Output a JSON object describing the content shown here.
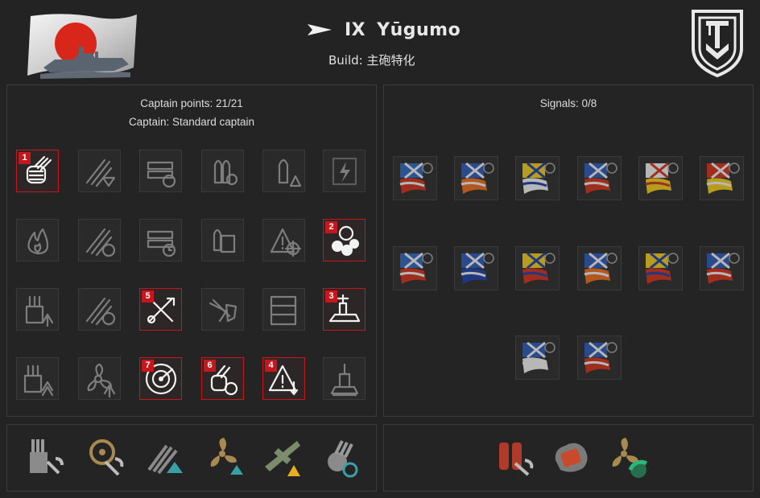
{
  "header": {
    "tier": "IX",
    "ship_name": "Yūgumo",
    "build_label": "Build: 主砲特化",
    "nation_flag_icon": "japan-flag-icon",
    "ship_class_icon": "destroyer-class-icon",
    "emblem_icon": "tier-emblem-icon"
  },
  "captain": {
    "points_text": "Captain points: 21/21",
    "captain_text": "Captain: Standard captain"
  },
  "skills": [
    {
      "icon": "main-battery-reload-icon",
      "selected": true,
      "order": "1"
    },
    {
      "icon": "torpedo-ready-alert-icon",
      "selected": false,
      "order": ""
    },
    {
      "icon": "consumable-reload-icon",
      "selected": false,
      "order": ""
    },
    {
      "icon": "shell-reload-icon",
      "selected": false,
      "order": ""
    },
    {
      "icon": "shell-warning-icon",
      "selected": false,
      "order": ""
    },
    {
      "icon": "lightning-icon",
      "selected": false,
      "order": ""
    },
    {
      "icon": "fire-icon",
      "selected": false,
      "order": ""
    },
    {
      "icon": "torpedo-speed-icon",
      "selected": false,
      "order": ""
    },
    {
      "icon": "consumable-timer-icon",
      "selected": false,
      "order": ""
    },
    {
      "icon": "ammo-crate-icon",
      "selected": false,
      "order": ""
    },
    {
      "icon": "target-warning-icon",
      "selected": false,
      "order": ""
    },
    {
      "icon": "smoke-helm-icon",
      "selected": true,
      "order": "2"
    },
    {
      "icon": "turret-upgrade-icon",
      "selected": false,
      "order": ""
    },
    {
      "icon": "torpedo-reload-icon",
      "selected": false,
      "order": ""
    },
    {
      "icon": "crossed-tools-icon",
      "selected": true,
      "order": "5"
    },
    {
      "icon": "aircraft-shield-icon",
      "selected": false,
      "order": ""
    },
    {
      "icon": "container-icon",
      "selected": false,
      "order": ""
    },
    {
      "icon": "battleship-icon",
      "selected": true,
      "order": "3"
    },
    {
      "icon": "turret-boost-icon",
      "selected": false,
      "order": ""
    },
    {
      "icon": "propeller-up-icon",
      "selected": false,
      "order": ""
    },
    {
      "icon": "radar-icon",
      "selected": true,
      "order": "7"
    },
    {
      "icon": "shell-cycle-icon",
      "selected": true,
      "order": "6"
    },
    {
      "icon": "warning-down-icon",
      "selected": true,
      "order": "4"
    },
    {
      "icon": "ship-silhouette-icon",
      "selected": false,
      "order": ""
    }
  ],
  "signals": {
    "count_text": "Signals: 0/8",
    "items": [
      {
        "icon": "signal-flag-1-icon",
        "colors": [
          "#2a62b8",
          "#e6e6e6",
          "#c8301a"
        ]
      },
      {
        "icon": "signal-flag-2-icon",
        "colors": [
          "#2a55b0",
          "#e6e6e6",
          "#e0661a"
        ]
      },
      {
        "icon": "signal-flag-3-icon",
        "colors": [
          "#e8c21a",
          "#1a3f9e",
          "#e6e6e6"
        ]
      },
      {
        "icon": "signal-flag-4-icon",
        "colors": [
          "#2a55b0",
          "#e6e6e6",
          "#c8301a"
        ]
      },
      {
        "icon": "signal-flag-5-icon",
        "colors": [
          "#e6e6e6",
          "#c8301a",
          "#e8c21a"
        ]
      },
      {
        "icon": "signal-flag-6-icon",
        "colors": [
          "#c8301a",
          "#e6e6e6",
          "#e8c21a"
        ]
      },
      {
        "icon": "signal-flag-7-icon",
        "colors": [
          "#2a62b8",
          "#e6e6e6",
          "#c8301a"
        ]
      },
      {
        "icon": "signal-flag-8-icon",
        "colors": [
          "#2a55b0",
          "#e6e6e6",
          "#1a3f9e"
        ]
      },
      {
        "icon": "signal-flag-9-icon",
        "colors": [
          "#e8c21a",
          "#1a3f9e",
          "#c8301a"
        ]
      },
      {
        "icon": "signal-flag-10-icon",
        "colors": [
          "#2a55b0",
          "#e6e6e6",
          "#e0661a"
        ]
      },
      {
        "icon": "signal-flag-11-icon",
        "colors": [
          "#e8c21a",
          "#1a3f9e",
          "#c8301a"
        ]
      },
      {
        "icon": "signal-flag-12-icon",
        "colors": [
          "#2a55b0",
          "#e6e6e6",
          "#c8301a"
        ]
      },
      {
        "icon": "signal-flag-13-icon",
        "colors": [
          "#2a55b0",
          "#e6e6e6",
          "#e6e6e6"
        ]
      },
      {
        "icon": "signal-flag-14-icon",
        "colors": [
          "#2a55b0",
          "#e6e6e6",
          "#c8301a"
        ]
      }
    ]
  },
  "upgrades": [
    {
      "icon": "main-armaments-modification-icon"
    },
    {
      "icon": "steering-gears-modification-icon"
    },
    {
      "icon": "torpedo-tubes-modification-icon"
    },
    {
      "icon": "propulsion-modification-icon"
    },
    {
      "icon": "aircraft-warning-modification-icon"
    },
    {
      "icon": "gun-reload-modification-icon"
    }
  ],
  "consumables": [
    {
      "icon": "damage-control-party-icon"
    },
    {
      "icon": "smoke-generator-icon"
    },
    {
      "icon": "engine-boost-icon"
    }
  ],
  "colors": {
    "background": "#232323",
    "selected_border": "#c8161d",
    "icon_inactive": "#7d7d7d",
    "icon_active": "#f2f2f2"
  }
}
